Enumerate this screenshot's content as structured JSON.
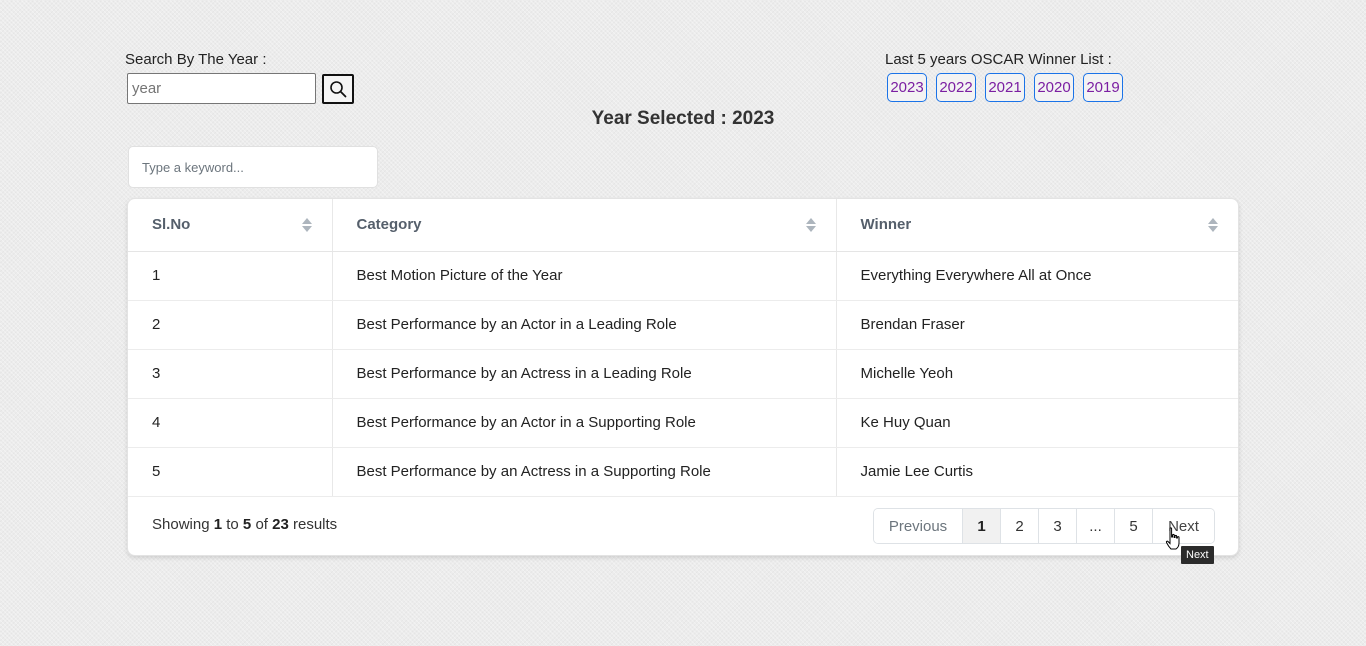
{
  "search": {
    "label": "Search By The Year :",
    "placeholder": "year",
    "button_icon": "search-icon"
  },
  "oscar": {
    "label": "Last 5 years OSCAR Winner List :",
    "years": [
      "2023",
      "2022",
      "2021",
      "2020",
      "2019"
    ],
    "link_color": "#7b1fa2",
    "border_color": "#1a73e8"
  },
  "selected": {
    "text": "Year Selected : 2023"
  },
  "filter": {
    "placeholder": "Type a keyword..."
  },
  "table": {
    "headers": [
      "Sl.No",
      "Category",
      "Winner"
    ],
    "rows": [
      [
        "1",
        "Best Motion Picture of the Year",
        "Everything Everywhere All at Once"
      ],
      [
        "2",
        "Best Performance by an Actor in a Leading Role",
        "Brendan Fraser"
      ],
      [
        "3",
        "Best Performance by an Actress in a Leading Role",
        "Michelle Yeoh"
      ],
      [
        "4",
        "Best Performance by an Actor in a Supporting Role",
        "Ke Huy Quan"
      ],
      [
        "5",
        "Best Performance by an Actress in a Supporting Role",
        "Jamie Lee Curtis"
      ]
    ]
  },
  "footer": {
    "showing_prefix": "Showing",
    "from": "1",
    "to_word": "to",
    "to": "5",
    "of_word": "of",
    "total": "23",
    "results_word": "results"
  },
  "pagination": {
    "previous": "Previous",
    "pages": [
      "1",
      "2",
      "3",
      "...",
      "5"
    ],
    "active_page": "1",
    "next": "Next"
  },
  "tooltip": {
    "text": "Next"
  }
}
